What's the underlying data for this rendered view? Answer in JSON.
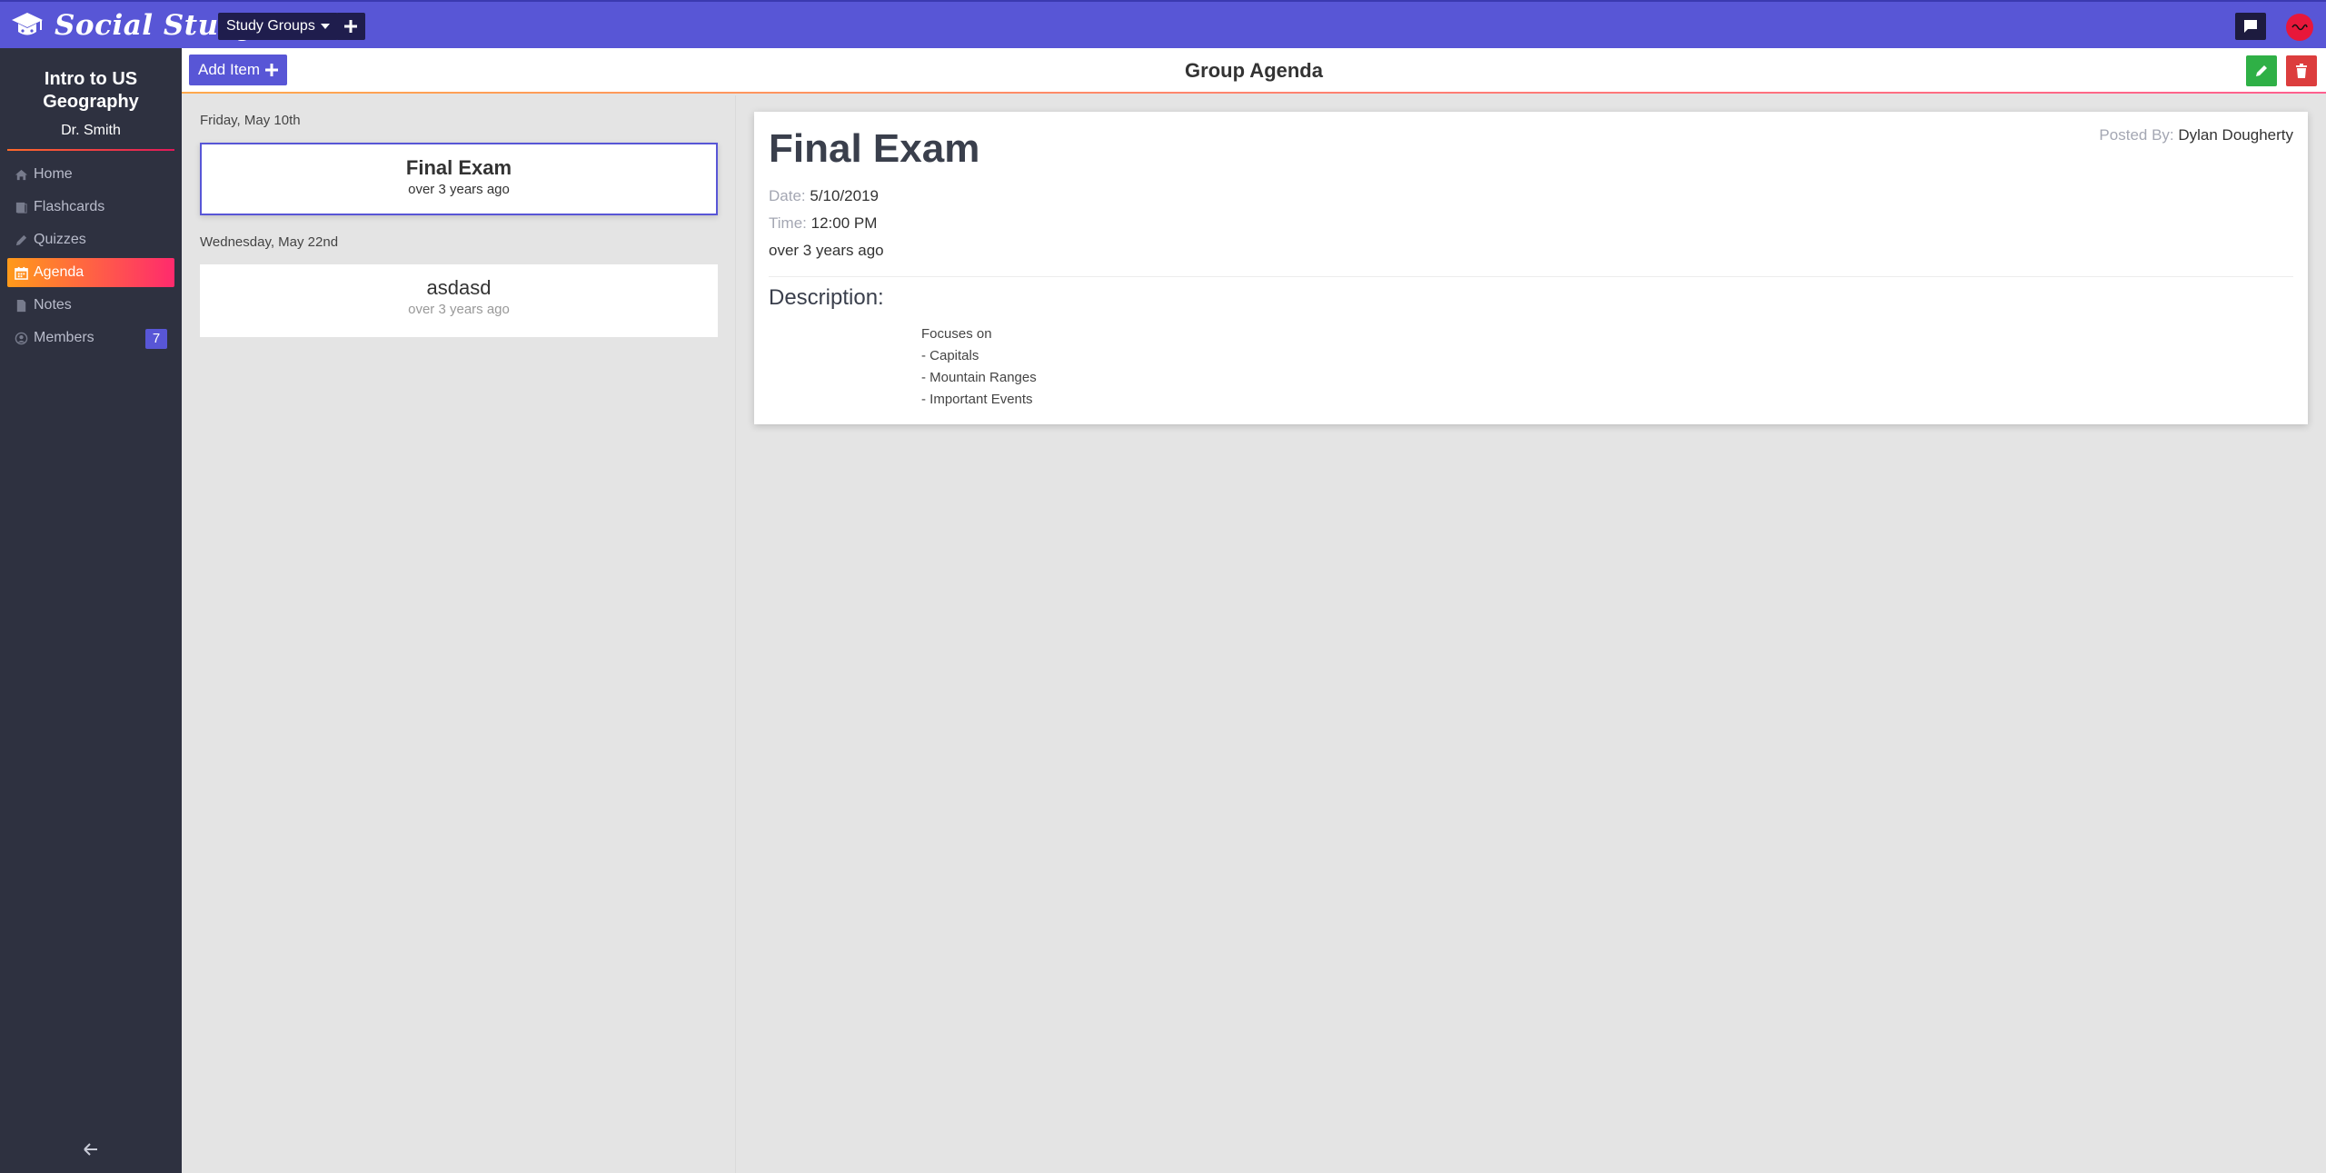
{
  "app": {
    "name": "Social Study"
  },
  "topbar": {
    "study_groups_label": "Study Groups"
  },
  "sidebar": {
    "group_title": "Intro to US Geography",
    "owner": "Dr. Smith",
    "items": [
      {
        "label": "Home",
        "icon": "home-icon"
      },
      {
        "label": "Flashcards",
        "icon": "flashcards-icon"
      },
      {
        "label": "Quizzes",
        "icon": "pencil-icon"
      },
      {
        "label": "Agenda",
        "icon": "calendar-icon",
        "active": true
      },
      {
        "label": "Notes",
        "icon": "notes-icon"
      },
      {
        "label": "Members",
        "icon": "user-icon",
        "badge": "7"
      }
    ]
  },
  "header": {
    "add_item_label": "Add Item",
    "title": "Group Agenda"
  },
  "agenda": {
    "groups": [
      {
        "date": "Friday, May 10th",
        "item": {
          "title": "Final Exam",
          "relative": "over 3 years ago"
        }
      },
      {
        "date": "Wednesday, May 22nd",
        "item": {
          "title": "asdasd",
          "relative": "over 3 years ago"
        }
      }
    ]
  },
  "detail": {
    "title": "Final Exam",
    "posted_by_label": "Posted By:",
    "posted_by": "Dylan Dougherty",
    "date_label": "Date:",
    "date": "5/10/2019",
    "time_label": "Time:",
    "time": "12:00 PM",
    "relative": "over 3 years ago",
    "description_heading": "Description:",
    "description_lines": [
      "Focuses on",
      "- Capitals",
      "- Mountain Ranges",
      "- Important Events"
    ]
  },
  "colors": {
    "primary": "#5856d6",
    "sidebar_bg": "#2e3140",
    "accent_gradient_start": "#ff9a1a",
    "accent_gradient_end": "#ff2a6d",
    "edit": "#2fb046",
    "delete": "#dc3d3d"
  }
}
